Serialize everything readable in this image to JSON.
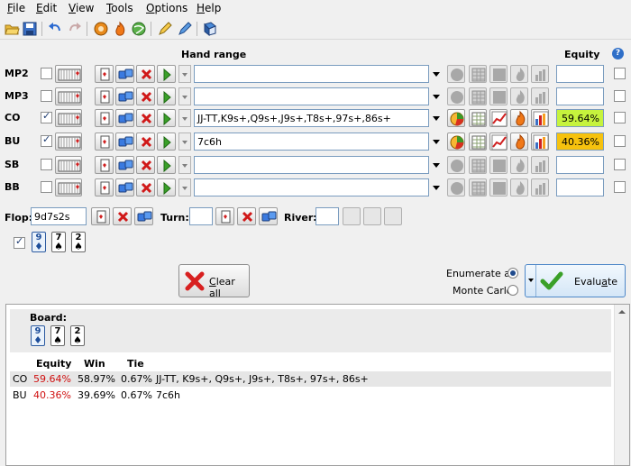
{
  "menu": [
    {
      "u": "F",
      "rest": "ile"
    },
    {
      "u": "E",
      "rest": "dit"
    },
    {
      "u": "V",
      "rest": "iew"
    },
    {
      "u": "T",
      "rest": "ools"
    },
    {
      "u": "O",
      "rest": "ptions"
    },
    {
      "u": "H",
      "rest": "elp"
    }
  ],
  "headers": {
    "hand_range": "Hand range",
    "equity": "Equity",
    "help": "?"
  },
  "players": [
    {
      "pos": "MP2",
      "enabled": false,
      "range": "",
      "equity": ""
    },
    {
      "pos": "MP3",
      "enabled": false,
      "range": "",
      "equity": ""
    },
    {
      "pos": "CO",
      "enabled": true,
      "range": "JJ-TT,K9s+,Q9s+,J9s+,T8s+,97s+,86s+",
      "equity": "59.64%"
    },
    {
      "pos": "BU",
      "enabled": true,
      "range": "7c6h",
      "equity": "40.36%"
    },
    {
      "pos": "SB",
      "enabled": false,
      "range": "",
      "equity": ""
    },
    {
      "pos": "BB",
      "enabled": false,
      "range": "",
      "equity": ""
    }
  ],
  "board": {
    "flop_label": "Flop:",
    "flop_value": "9d7s2s",
    "turn_label": "Turn:",
    "turn_value": "",
    "river_label": "River:",
    "river_value": "",
    "cards": [
      {
        "rank": "9",
        "suit": "♦"
      },
      {
        "rank": "7",
        "suit": "♠"
      },
      {
        "rank": "2",
        "suit": "♠"
      }
    ]
  },
  "actions": {
    "clear": {
      "u": "C",
      "rest": "lear all"
    },
    "enumerate_all": "Enumerate all",
    "monte_carlo": "Monte Carlo",
    "evaluate": {
      "pre": "Evalu",
      "u": "a",
      "rest": "te"
    }
  },
  "results": {
    "board_label": "Board:",
    "columns": {
      "equity": "Equity",
      "win": "Win",
      "tie": "Tie"
    },
    "rows": [
      {
        "pos": "CO",
        "equity": "59.64%",
        "win": "58.97%",
        "tie": "0.67%",
        "range": "JJ-TT, K9s+, Q9s+, J9s+, T8s+, 97s+, 86s+"
      },
      {
        "pos": "BU",
        "equity": "40.36%",
        "win": "39.69%",
        "tie": "0.67%",
        "range": "7c6h"
      }
    ]
  },
  "colors": {
    "equity_high": "#c6f33d",
    "equity_low": "#f6c20e",
    "equity_text": "#d01010"
  }
}
